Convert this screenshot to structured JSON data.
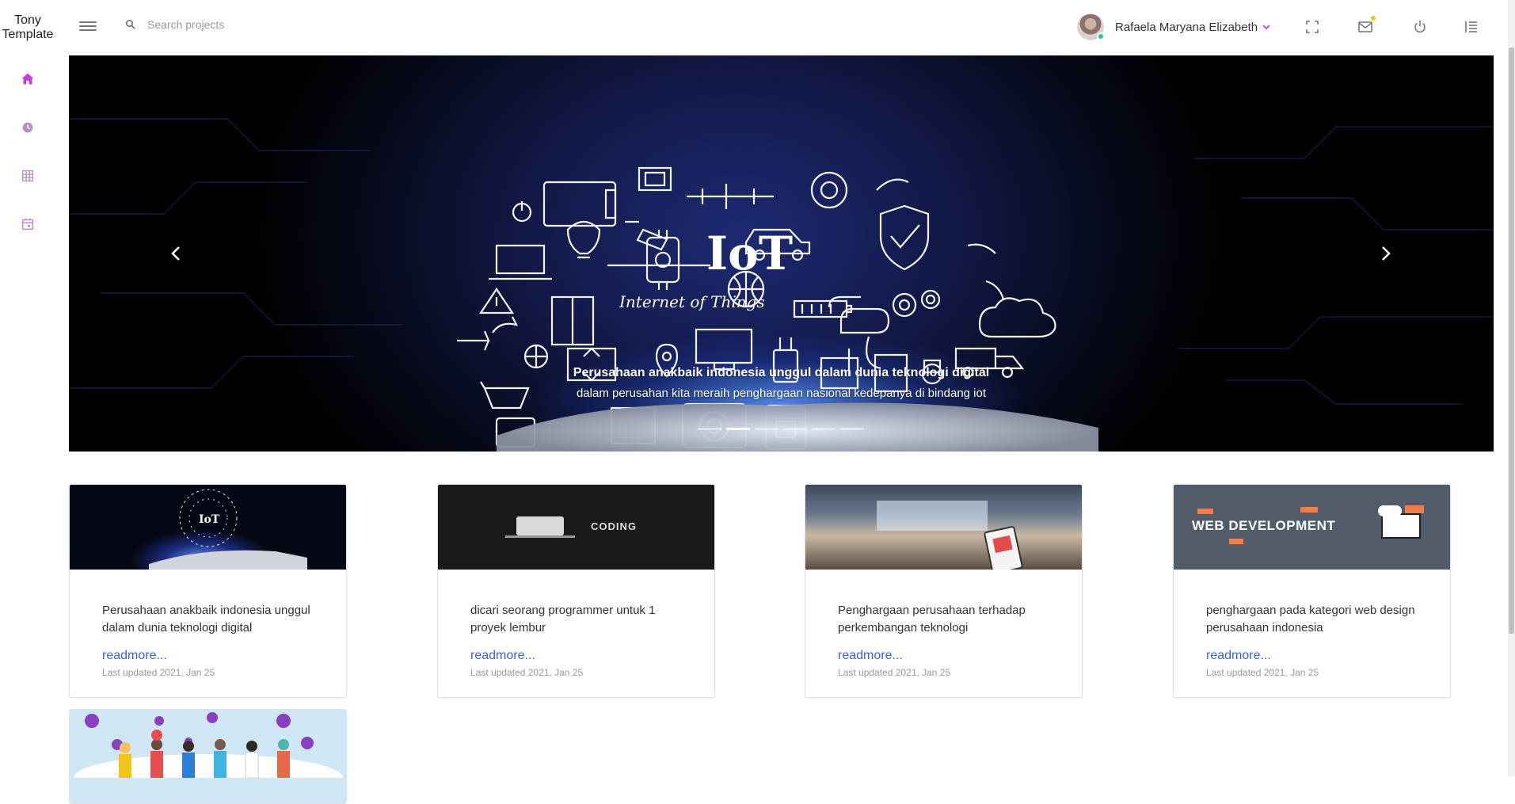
{
  "brand": {
    "line1": "Tony",
    "line2": "Template"
  },
  "search": {
    "placeholder": "Search projects"
  },
  "user": {
    "name": "Rafaela Maryana Elizabeth",
    "status": "online"
  },
  "header_icons": [
    "fullscreen-icon",
    "mail-icon",
    "power-icon",
    "list-settings-icon"
  ],
  "sidebar": {
    "items": [
      "home-icon",
      "clock-icon",
      "table-icon",
      "calendar-icon"
    ],
    "active": 0
  },
  "carousel": {
    "art_title": "IoT",
    "art_subtitle": "Internet of Things",
    "caption_title": "Perusahaan anakbaik indonesia unggul dalam dunia teknologi digital",
    "caption_text": "dalam perusahan kita meraih penghargaan nasional kedepanya di bindang iot",
    "slide_count": 6,
    "active_index": 1
  },
  "cards": [
    {
      "image": "iot",
      "title": "Perusahaan anakbaik indonesia unggul dalam dunia teknologi digital",
      "link": "readmore...",
      "updated": "Last updated 2021, Jan 25"
    },
    {
      "image": "coding",
      "image_text": "CODING",
      "title": "dicari seorang programmer untuk 1 proyek lembur",
      "link": "readmore...",
      "updated": "Last updated 2021, Jan 25"
    },
    {
      "image": "smart-home",
      "title": "Penghargaan perusahaan terhadap perkembangan teknologi",
      "link": "readmore...",
      "updated": "Last updated 2021, Jan 25"
    },
    {
      "image": "web-development",
      "image_text": "WEB DEVELOPMENT",
      "title": "penghargaan pada kategori web design perusahaan indonesia",
      "link": "readmore...",
      "updated": "Last updated 2021, Jan 25"
    }
  ],
  "colors": {
    "accent": "#c03fd6",
    "link": "#3b62e0",
    "online": "#20c997",
    "notify": "#f5c518"
  }
}
